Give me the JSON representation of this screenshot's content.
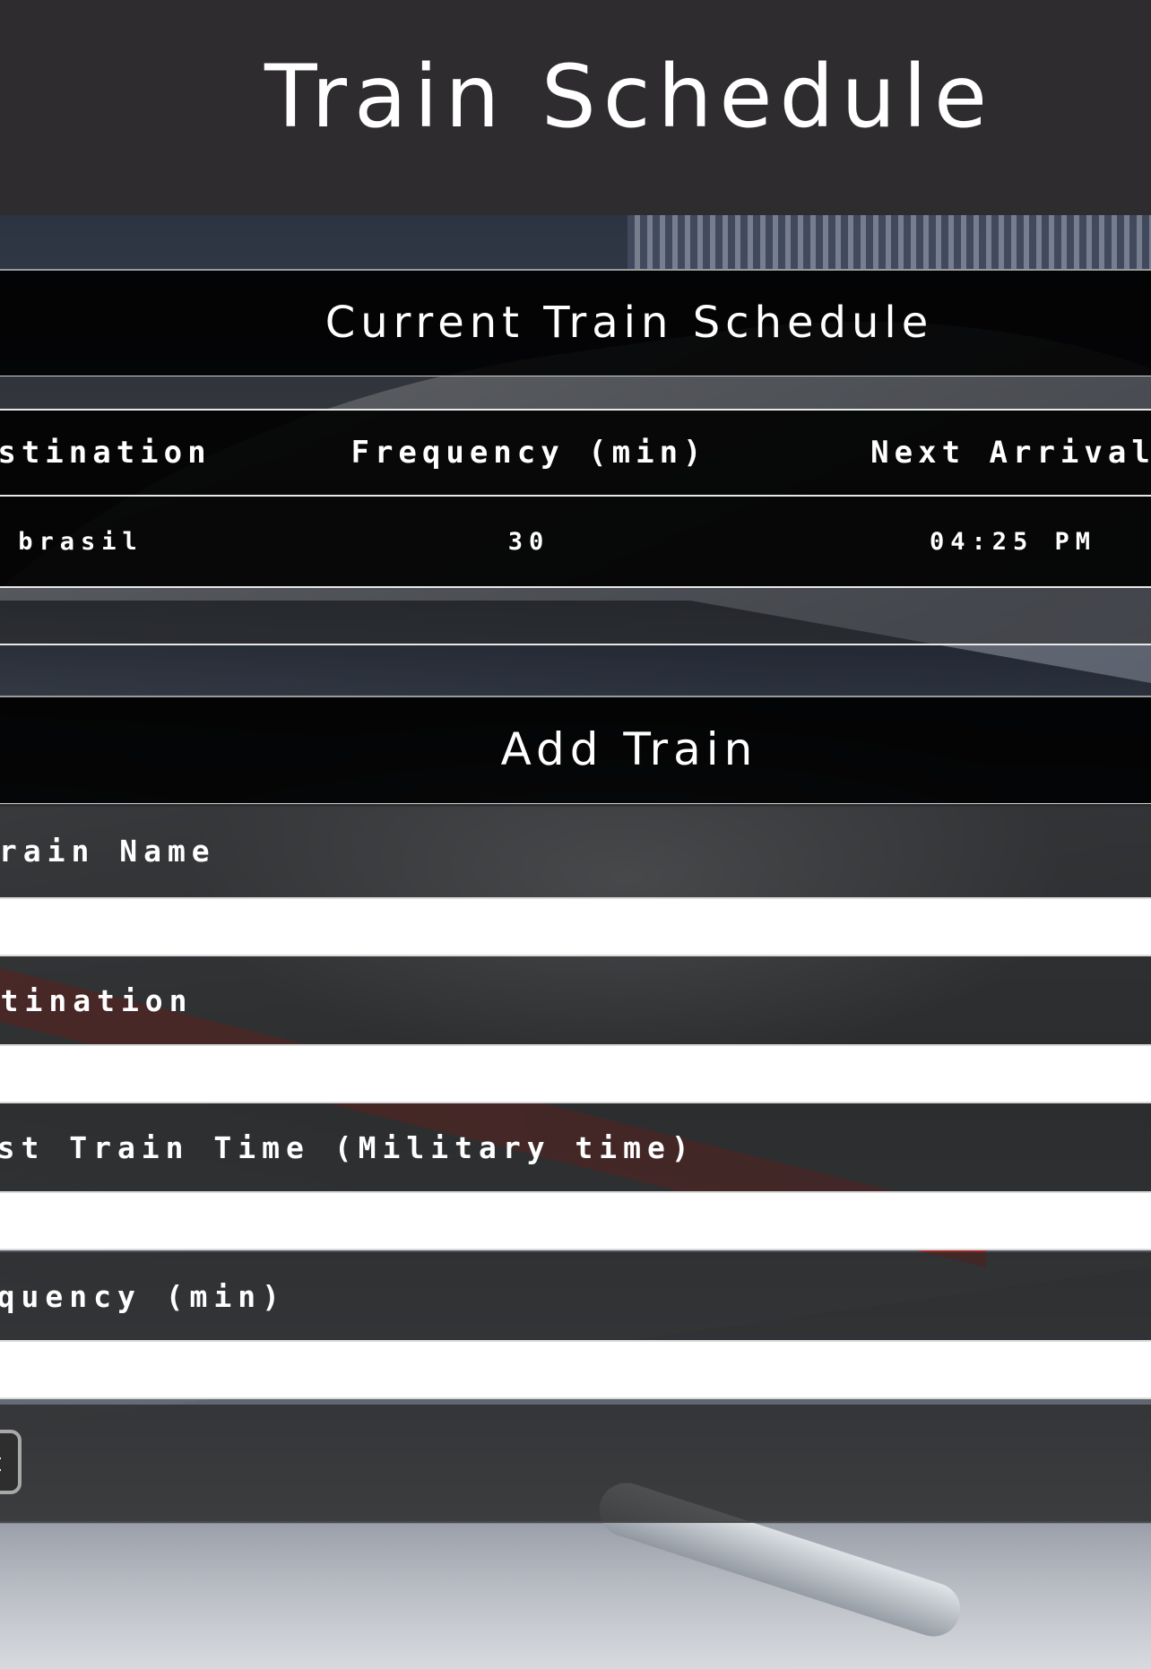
{
  "header": {
    "title": "Train Schedule"
  },
  "schedule": {
    "heading": "Current Train Schedule",
    "columns": [
      "Destination",
      "Frequency (min)",
      "Next Arrival"
    ],
    "rows": [
      {
        "destination": "brasil",
        "frequency": "30",
        "next_arrival": "04:25 PM"
      }
    ]
  },
  "add_train": {
    "heading": "Add Train",
    "fields": [
      {
        "label": "Train Name",
        "value": ""
      },
      {
        "label": "Destination",
        "value": ""
      },
      {
        "label": "First Train Time (Military time)",
        "value": ""
      },
      {
        "label": "Frequency (min)",
        "value": ""
      }
    ],
    "submit_label": "Submit"
  },
  "colors": {
    "header_bg": "#2e2c2e",
    "panel_heading_bg": "#000000",
    "text": "#ffffff",
    "input_bg": "#ffffff"
  }
}
